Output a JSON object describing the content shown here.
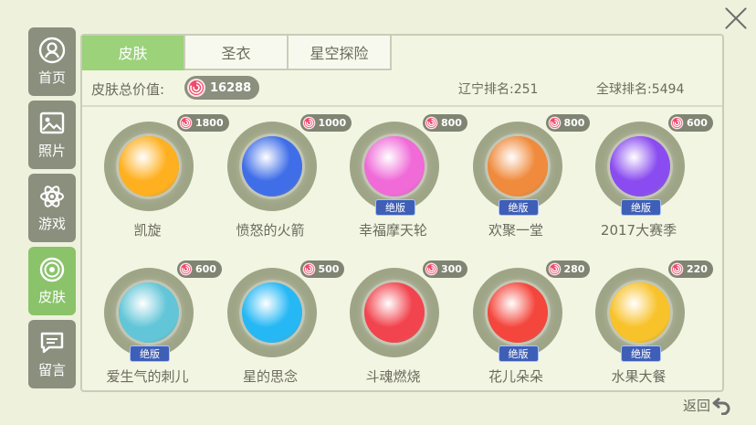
{
  "sidebar": {
    "items": [
      {
        "label": "首页",
        "icon": "user-icon"
      },
      {
        "label": "照片",
        "icon": "photo-icon"
      },
      {
        "label": "游戏",
        "icon": "atom-icon"
      },
      {
        "label": "皮肤",
        "icon": "skin-icon"
      },
      {
        "label": "留言",
        "icon": "message-icon"
      }
    ]
  },
  "tabs": [
    "皮肤",
    "圣衣",
    "星空探险"
  ],
  "info": {
    "total_label": "皮肤总价值:",
    "total_value": "16288",
    "local_rank": "辽宁排名:251",
    "global_rank": "全球排名:5494"
  },
  "skins": [
    {
      "name": "凯旋",
      "price": "1800",
      "badge": "",
      "color": "#ffb020"
    },
    {
      "name": "愤怒的火箭",
      "price": "1000",
      "badge": "",
      "color": "#3f6ee8"
    },
    {
      "name": "幸福摩天轮",
      "price": "800",
      "badge": "绝版",
      "color": "#f06ad8"
    },
    {
      "name": "欢聚一堂",
      "price": "800",
      "badge": "绝版",
      "color": "#f08a3c"
    },
    {
      "name": "2017大赛季",
      "price": "600",
      "badge": "绝版",
      "color": "#8a4cf0"
    },
    {
      "name": "爱生气的刺儿",
      "price": "600",
      "badge": "绝版",
      "color": "#63c6d8"
    },
    {
      "name": "星的思念",
      "price": "500",
      "badge": "",
      "color": "#26b8f5"
    },
    {
      "name": "斗魂燃烧",
      "price": "300",
      "badge": "",
      "color": "#f2444e"
    },
    {
      "name": "花儿朵朵",
      "price": "280",
      "badge": "绝版",
      "color": "#f4463c"
    },
    {
      "name": "水果大餐",
      "price": "220",
      "badge": "绝版",
      "color": "#f8c22a"
    }
  ],
  "back_label": "返回",
  "colors": {
    "accent": "#9bd27a",
    "sidebar": "#8b8f7e",
    "badge": "#3f5fb6"
  }
}
